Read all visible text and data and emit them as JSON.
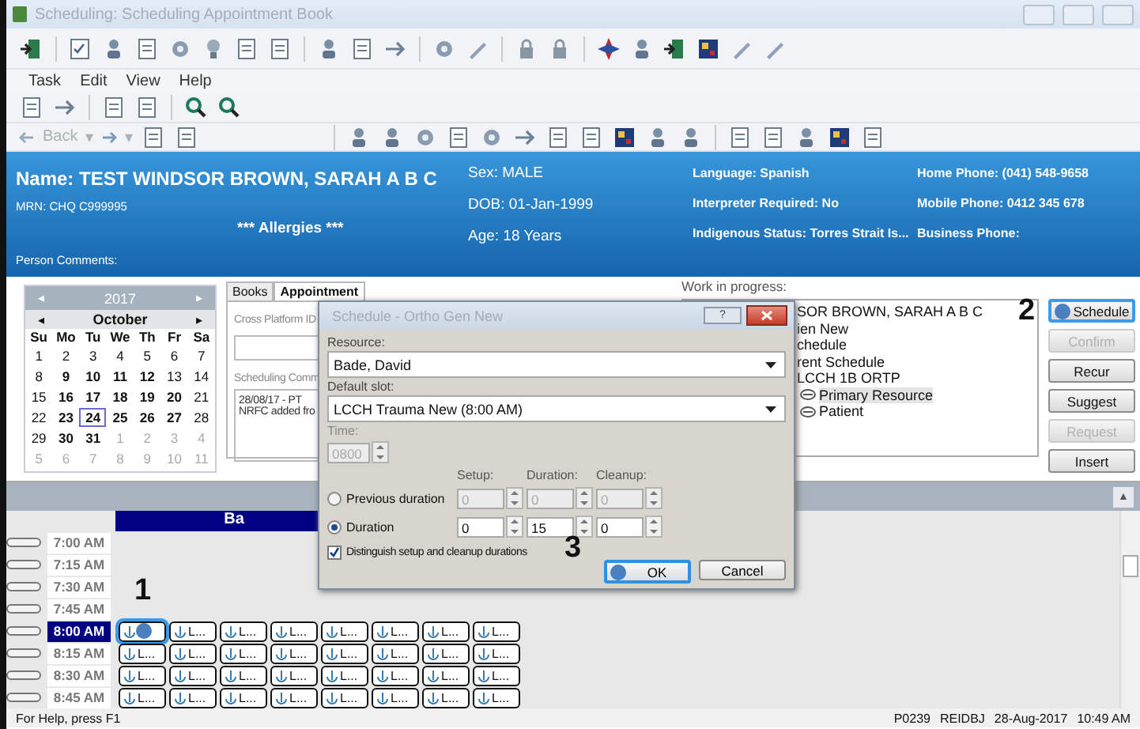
{
  "window": {
    "title": "Scheduling: Scheduling Appointment Book"
  },
  "menu": [
    "Task",
    "Edit",
    "View",
    "Help"
  ],
  "nav": {
    "back": {
      "label": "Back",
      "disabled": true
    },
    "dropdown": "▾"
  },
  "patient": {
    "name": "Name: TEST WINDSOR BROWN, SARAH A B C",
    "mrn": "MRN: CHQ C999995",
    "allergies": "*** Allergies ***",
    "comments": "Person Comments:",
    "col2": [
      "Sex: MALE",
      "DOB: 01-Jan-1999",
      "Age:  18 Years"
    ],
    "col3": [
      "Language: Spanish",
      "Interpreter Required: No",
      "Indigenous Status: Torres Strait Is..."
    ],
    "col4": [
      "Home Phone: (041) 548-9658",
      "Mobile Phone: 0412 345 678",
      "Business Phone:"
    ]
  },
  "calendar": {
    "year": "2017",
    "month": "October",
    "prev": "◂",
    "next": "▸",
    "weekdays": [
      "Su",
      "Mo",
      "Tu",
      "We",
      "Th",
      "Fr",
      "Sa"
    ],
    "weeks": [
      [
        {
          "label": "1",
          "kind": "normal",
          "selected": false
        },
        {
          "label": "2",
          "kind": "normal",
          "selected": false
        },
        {
          "label": "3",
          "kind": "normal",
          "selected": false
        },
        {
          "label": "4",
          "kind": "normal",
          "selected": false
        },
        {
          "label": "5",
          "kind": "normal",
          "selected": false
        },
        {
          "label": "6",
          "kind": "normal",
          "selected": false
        },
        {
          "label": "7",
          "kind": "normal",
          "selected": false
        }
      ],
      [
        {
          "label": "8",
          "kind": "normal",
          "selected": false
        },
        {
          "label": "9",
          "kind": "busy",
          "selected": false
        },
        {
          "label": "10",
          "kind": "busy",
          "selected": false
        },
        {
          "label": "11",
          "kind": "busy",
          "selected": false
        },
        {
          "label": "12",
          "kind": "busy",
          "selected": false
        },
        {
          "label": "13",
          "kind": "normal",
          "selected": false
        },
        {
          "label": "14",
          "kind": "normal",
          "selected": false
        }
      ],
      [
        {
          "label": "15",
          "kind": "normal",
          "selected": false
        },
        {
          "label": "16",
          "kind": "busy",
          "selected": false
        },
        {
          "label": "17",
          "kind": "busy",
          "selected": false
        },
        {
          "label": "18",
          "kind": "busy",
          "selected": false
        },
        {
          "label": "19",
          "kind": "busy",
          "selected": false
        },
        {
          "label": "20",
          "kind": "busy",
          "selected": false
        },
        {
          "label": "21",
          "kind": "normal",
          "selected": false
        }
      ],
      [
        {
          "label": "22",
          "kind": "normal",
          "selected": false
        },
        {
          "label": "23",
          "kind": "busy",
          "selected": false
        },
        {
          "label": "24",
          "kind": "busy",
          "selected": true
        },
        {
          "label": "25",
          "kind": "busy",
          "selected": false
        },
        {
          "label": "26",
          "kind": "busy",
          "selected": false
        },
        {
          "label": "27",
          "kind": "busy",
          "selected": false
        },
        {
          "label": "28",
          "kind": "normal",
          "selected": false
        }
      ],
      [
        {
          "label": "29",
          "kind": "normal",
          "selected": false
        },
        {
          "label": "30",
          "kind": "busy",
          "selected": false
        },
        {
          "label": "31",
          "kind": "busy",
          "selected": false
        },
        {
          "label": "1",
          "kind": "other",
          "selected": false
        },
        {
          "label": "2",
          "kind": "other",
          "selected": false
        },
        {
          "label": "3",
          "kind": "other",
          "selected": false
        },
        {
          "label": "4",
          "kind": "other",
          "selected": false
        }
      ],
      [
        {
          "label": "5",
          "kind": "other",
          "selected": false
        },
        {
          "label": "6",
          "kind": "other",
          "selected": false
        },
        {
          "label": "7",
          "kind": "other",
          "selected": false
        },
        {
          "label": "8",
          "kind": "other",
          "selected": false
        },
        {
          "label": "9",
          "kind": "other",
          "selected": false
        },
        {
          "label": "10",
          "kind": "other",
          "selected": false
        },
        {
          "label": "11",
          "kind": "other",
          "selected": false
        }
      ]
    ]
  },
  "appointment_panel": {
    "tabs": [
      {
        "label": "Books",
        "selected": false
      },
      {
        "label": "Appointment",
        "selected": true
      }
    ],
    "cross_platform_label": "Cross Platform ID",
    "comments_label": "Scheduling Comm",
    "comments": [
      "28/08/17 - PT",
      "NRFC added fro"
    ]
  },
  "work_in_progress": {
    "label": "Work in progress:",
    "items": [
      {
        "label": "SOR BROWN, SARAH A B C",
        "selected": false,
        "children": [
          {
            "label": "ien New",
            "selected": false
          },
          {
            "label": "chedule",
            "selected": false
          },
          {
            "label": "rent Schedule",
            "selected": false
          },
          {
            "label": "LCCH 1B ORTP",
            "selected": false,
            "children": [
              {
                "label": "Primary Resource",
                "selected": true
              },
              {
                "label": "Patient",
                "selected": false
              }
            ]
          }
        ]
      }
    ]
  },
  "actions": [
    {
      "label": "Schedule",
      "disabled": false,
      "focused": true,
      "dot": true
    },
    {
      "label": "Confirm",
      "disabled": true,
      "focused": false,
      "dot": false
    },
    {
      "label": "Recur",
      "disabled": false,
      "focused": false,
      "dot": false
    },
    {
      "label": "Suggest",
      "disabled": false,
      "focused": false,
      "dot": false
    },
    {
      "label": "Request",
      "disabled": true,
      "focused": false,
      "dot": false
    },
    {
      "label": "Insert",
      "disabled": false,
      "focused": false,
      "dot": false
    }
  ],
  "book": {
    "collapse": "▲",
    "column": "Ba",
    "rows": [
      {
        "time": "7:00 AM",
        "selected": false,
        "slots": []
      },
      {
        "time": "7:15 AM",
        "selected": false,
        "slots": []
      },
      {
        "time": "7:30 AM",
        "selected": false,
        "slots": []
      },
      {
        "time": "7:45 AM",
        "selected": false,
        "slots": []
      },
      {
        "time": "8:00 AM",
        "selected": true,
        "slots": [
          {
            "selected": true,
            "dot": true
          },
          {
            "label": "L...",
            "selected": false,
            "dot": false
          },
          {
            "label": "L...",
            "selected": false,
            "dot": false
          },
          {
            "label": "L...",
            "selected": false,
            "dot": false
          },
          {
            "label": "L...",
            "selected": false,
            "dot": false
          },
          {
            "label": "L...",
            "selected": false,
            "dot": false
          },
          {
            "label": "L...",
            "selected": false,
            "dot": false
          },
          {
            "label": "L...",
            "selected": false,
            "dot": false
          }
        ]
      },
      {
        "time": "8:15 AM",
        "selected": false,
        "slots": [
          {
            "label": "L...",
            "selected": false,
            "dot": false
          },
          {
            "label": "L...",
            "selected": false,
            "dot": false
          },
          {
            "label": "L...",
            "selected": false,
            "dot": false
          },
          {
            "label": "L...",
            "selected": false,
            "dot": false
          },
          {
            "label": "L...",
            "selected": false,
            "dot": false
          },
          {
            "label": "L...",
            "selected": false,
            "dot": false
          },
          {
            "label": "L...",
            "selected": false,
            "dot": false
          },
          {
            "label": "L...",
            "selected": false,
            "dot": false
          }
        ]
      },
      {
        "time": "8:30 AM",
        "selected": false,
        "slots": [
          {
            "label": "L...",
            "selected": false,
            "dot": false
          },
          {
            "label": "L...",
            "selected": false,
            "dot": false
          },
          {
            "label": "L...",
            "selected": false,
            "dot": false
          },
          {
            "label": "L...",
            "selected": false,
            "dot": false
          },
          {
            "label": "L...",
            "selected": false,
            "dot": false
          },
          {
            "label": "L...",
            "selected": false,
            "dot": false
          },
          {
            "label": "L...",
            "selected": false,
            "dot": false
          },
          {
            "label": "L...",
            "selected": false,
            "dot": false
          }
        ]
      },
      {
        "time": "8:45 AM",
        "selected": false,
        "slots": [
          {
            "label": "L...",
            "selected": false,
            "dot": false
          },
          {
            "label": "L...",
            "selected": false,
            "dot": false
          },
          {
            "label": "L...",
            "selected": false,
            "dot": false
          },
          {
            "label": "L...",
            "selected": false,
            "dot": false
          },
          {
            "label": "L...",
            "selected": false,
            "dot": false
          },
          {
            "label": "L...",
            "selected": false,
            "dot": false
          },
          {
            "label": "L...",
            "selected": false,
            "dot": false
          },
          {
            "label": "L...",
            "selected": false,
            "dot": false
          }
        ]
      }
    ]
  },
  "status_bar": {
    "help": "For Help, press F1",
    "fields": [
      "P0239",
      "REIDBJ",
      "28-Aug-2017",
      "10:49 AM"
    ]
  },
  "dialog": {
    "title": "Schedule - Ortho Gen New",
    "help": "?",
    "resource_label": "Resource:",
    "resource": "Bade, David",
    "slot_label": "Default slot:",
    "slot": "LCCH Trauma New (8:00 AM)",
    "time_label": "Time:",
    "time": "0800",
    "time_disabled": true,
    "columns": [
      "Setup:",
      "Duration:",
      "Cleanup:"
    ],
    "options": [
      {
        "label": "Previous duration",
        "selected": false,
        "disabled": true,
        "values": [
          "0",
          "0",
          "0"
        ]
      },
      {
        "label": "Duration",
        "selected": true,
        "disabled": false,
        "values": [
          "0",
          "15",
          "0"
        ]
      }
    ],
    "distinguish": {
      "label": "Distinguish setup and cleanup durations",
      "checked": true
    },
    "buttons": [
      {
        "label": "OK",
        "focused": true,
        "dot": true
      },
      {
        "label": "Cancel",
        "focused": false,
        "dot": false
      }
    ]
  },
  "markers": [
    "1",
    "2",
    "3"
  ]
}
